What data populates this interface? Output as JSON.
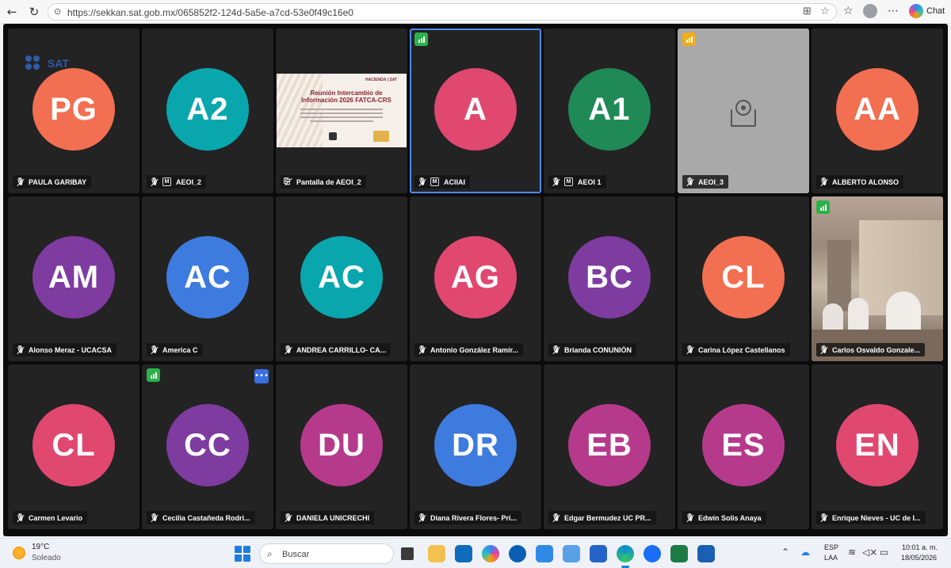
{
  "browser": {
    "url": "https://sekkan.sat.gob.mx/065852f2-124d-5a5e-a7cd-53e0f49c16e0",
    "chat_label": "Chat"
  },
  "participants": [
    {
      "initials": "PG",
      "name": "PAULA GARIBAY",
      "color": "#f26f51",
      "muted": true,
      "badge_m": false,
      "logo": "SAT"
    },
    {
      "initials": "A2",
      "name": "AEOI_2",
      "color": "#0aa6ad",
      "muted": true,
      "badge_m": true
    },
    {
      "initials": "",
      "name": "Pantalla de AEOI_2",
      "type": "screen",
      "slide": {
        "logos": "HACIENDA  |  SAT",
        "title": "Reunión Intercambio de Información 2026 FATCA-CRS"
      }
    },
    {
      "initials": "A",
      "name": "ACIIAI",
      "color": "#e04870",
      "muted": true,
      "badge_m": true,
      "active": true,
      "signal": "#2cb24a"
    },
    {
      "initials": "A1",
      "name": "AEOI 1",
      "color": "#1f8a56",
      "muted": true,
      "badge_m": true
    },
    {
      "initials": "",
      "name": "AEOI_3",
      "type": "camera-off",
      "muted": true,
      "signal": "#f0ad1c"
    },
    {
      "initials": "AA",
      "name": "ALBERTO ALONSO",
      "color": "#f26f51",
      "muted": true
    },
    {
      "initials": "AM",
      "name": "Alonso Meraz - UCACSA",
      "color": "#7e3ba0",
      "muted": true
    },
    {
      "initials": "AC",
      "name": "America C",
      "color": "#3d7bde",
      "muted": true
    },
    {
      "initials": "AC",
      "name": "ANDREA CARRILLO- CA...",
      "color": "#0aa6ad",
      "muted": true
    },
    {
      "initials": "AG",
      "name": "Antonio González Ramír...",
      "color": "#e04870",
      "muted": true
    },
    {
      "initials": "BC",
      "name": "Brianda CONUNIÓN",
      "color": "#7e3ba0",
      "muted": true
    },
    {
      "initials": "CL",
      "name": "Carina López Castellanos",
      "color": "#f26f51",
      "muted": true
    },
    {
      "initials": "",
      "name": "Carlos Osvaldo Gonzale...",
      "type": "video",
      "muted": true,
      "signal": "#2cb24a"
    },
    {
      "initials": "CL",
      "name": "Carmen Levario",
      "color": "#e04870",
      "muted": true
    },
    {
      "initials": "CC",
      "name": "Cecilia Castañeda Rodri...",
      "color": "#7e3ba0",
      "muted": true,
      "signal": "#2cb24a",
      "more": true
    },
    {
      "initials": "DU",
      "name": "DANIELA UNICRECHI",
      "color": "#b63a8c",
      "muted": true
    },
    {
      "initials": "DR",
      "name": "Diana Rivera Flores- Pri...",
      "color": "#3d7bde",
      "muted": true
    },
    {
      "initials": "EB",
      "name": "Edgar Bermudez UC PR...",
      "color": "#b63a8c",
      "muted": true
    },
    {
      "initials": "ES",
      "name": "Edwin Solis Anaya",
      "color": "#b63a8c",
      "muted": true
    },
    {
      "initials": "EN",
      "name": "Enrique Nieves - UC de I...",
      "color": "#e04870",
      "muted": true
    }
  ],
  "taskbar": {
    "temperature": "19°C",
    "weather": "Soleado",
    "search_placeholder": "Buscar",
    "lang1": "ESP",
    "lang2": "LAA",
    "time": "10:01 a. m.",
    "date": "18/05/2026"
  }
}
